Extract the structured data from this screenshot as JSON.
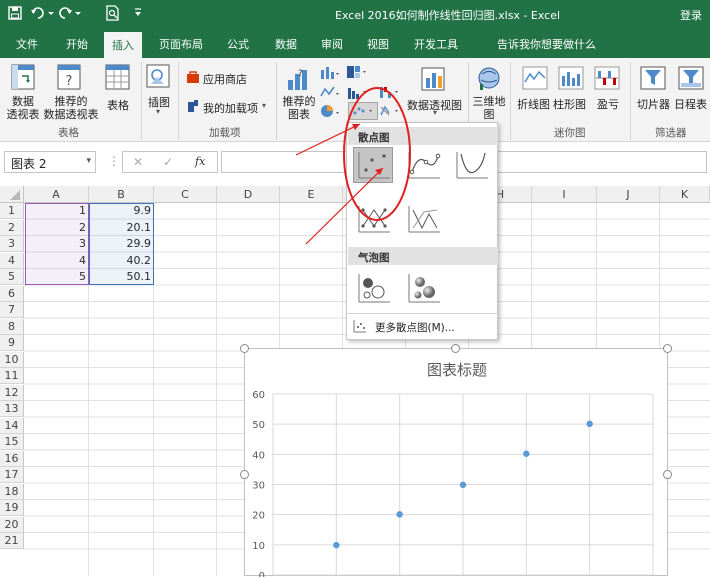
{
  "title_bar": {
    "window_title": "Excel 2016如何制作线性回归图.xlsx  -  Excel",
    "login": "登录"
  },
  "tabs": [
    {
      "label": "文件"
    },
    {
      "label": "开始"
    },
    {
      "label": "插入",
      "active": true
    },
    {
      "label": "页面布局"
    },
    {
      "label": "公式"
    },
    {
      "label": "数据"
    },
    {
      "label": "审阅"
    },
    {
      "label": "视图"
    },
    {
      "label": "开发工具"
    },
    {
      "label": "告诉我你想要做什么"
    }
  ],
  "ribbon": {
    "tables": {
      "pivot_line1": "数据",
      "pivot_line2": "透视表",
      "recommended_line1": "推荐的",
      "recommended_line2": "数据透视表",
      "table": "表格",
      "group": "表格"
    },
    "illustrations": {
      "label": "插图"
    },
    "addins": {
      "store": "应用商店",
      "my_addins": "我的加载项",
      "group": "加载项"
    },
    "charts": {
      "recommended_line1": "推荐的",
      "recommended_line2": "图表",
      "pivot_chart": "数据透视图"
    },
    "tours": {
      "label_line1": "三维地",
      "label_line2": "图"
    },
    "sparklines": {
      "line": "折线图",
      "column": "柱形图",
      "winloss": "盈亏",
      "group": "迷你图"
    },
    "filters": {
      "slicer": "切片器",
      "timeline": "日程表",
      "group": "筛选器"
    }
  },
  "formula_bar": {
    "name_box": "图表 2",
    "fx": "fx",
    "cancel": "✕",
    "enter": "✓"
  },
  "sheet": {
    "columns": [
      "A",
      "B",
      "C",
      "D",
      "E",
      "F",
      "G",
      "H",
      "I",
      "J",
      "K"
    ],
    "rows": [
      "1",
      "2",
      "3",
      "4",
      "5",
      "6",
      "7",
      "8",
      "9",
      "10",
      "11",
      "12",
      "13",
      "14",
      "15",
      "16",
      "17",
      "18",
      "19",
      "20",
      "21"
    ],
    "col_a_values": [
      "1",
      "2",
      "3",
      "4",
      "5"
    ],
    "col_b_values": [
      "9.9",
      "20.1",
      "29.9",
      "40.2",
      "50.1"
    ]
  },
  "scatter_dropdown": {
    "section_scatter": "散点图",
    "section_bubble": "气泡图",
    "more": "更多散点图(M)..."
  },
  "chart_data": {
    "type": "scatter",
    "title": "图表标题",
    "x": [
      1,
      2,
      3,
      4,
      5
    ],
    "series": [
      {
        "values": [
          9.9,
          20.1,
          29.9,
          40.2,
          50.1
        ]
      }
    ],
    "ylim": [
      0,
      60
    ],
    "yticks": [
      "0",
      "10",
      "20",
      "30",
      "40",
      "50",
      "60"
    ],
    "grid": true,
    "marker_color": "#5b9bd5"
  },
  "colors": {
    "brand_green": "#217346",
    "annotation_red": "#e02020"
  }
}
